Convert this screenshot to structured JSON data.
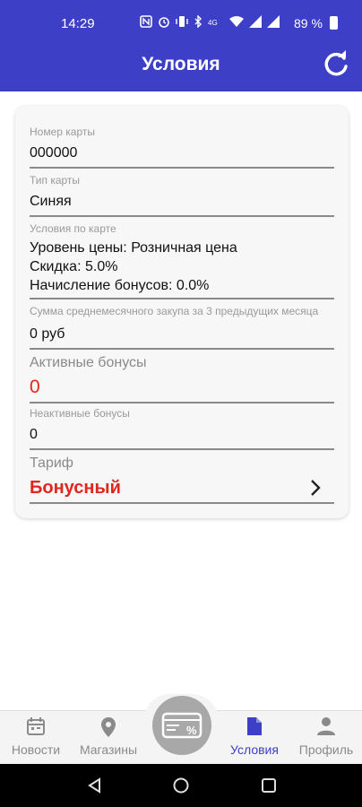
{
  "status_bar": {
    "time": "14:29",
    "battery": "89 %"
  },
  "app_bar": {
    "title": "Условия",
    "refresh_icon": "refresh-icon"
  },
  "card": {
    "card_number": {
      "label": "Номер карты",
      "value": "000000"
    },
    "card_type": {
      "label": "Тип карты",
      "value": "Синяя"
    },
    "card_conditions": {
      "label": "Условия по карте",
      "lines": [
        "Уровень цены: Розничная цена",
        "Скидка: 5.0%",
        "Начисление бонусов: 0.0%"
      ]
    },
    "monthly_sum": {
      "label": "Сумма среднемесячного закупа за 3 предыдущих месяца",
      "value": "0 руб"
    },
    "active_bonuses": {
      "label": "Активные бонусы",
      "value": "0"
    },
    "inactive_bonuses": {
      "label": "Неактивные бонусы",
      "value": "0"
    },
    "tariff": {
      "label": "Тариф",
      "value": "Бонусный"
    }
  },
  "bottom_nav": {
    "items": [
      {
        "label": "Новости",
        "icon": "calendar-icon"
      },
      {
        "label": "Магазины",
        "icon": "location-pin-icon"
      },
      {
        "label": "Условия",
        "icon": "document-icon",
        "active": true
      },
      {
        "label": "Профиль",
        "icon": "person-icon"
      }
    ],
    "center_button_icon": "discount-card-icon"
  },
  "colors": {
    "primary": "#3d3fc6",
    "accent_red": "#e0261d",
    "inactive_nav": "#8a8a8a"
  }
}
